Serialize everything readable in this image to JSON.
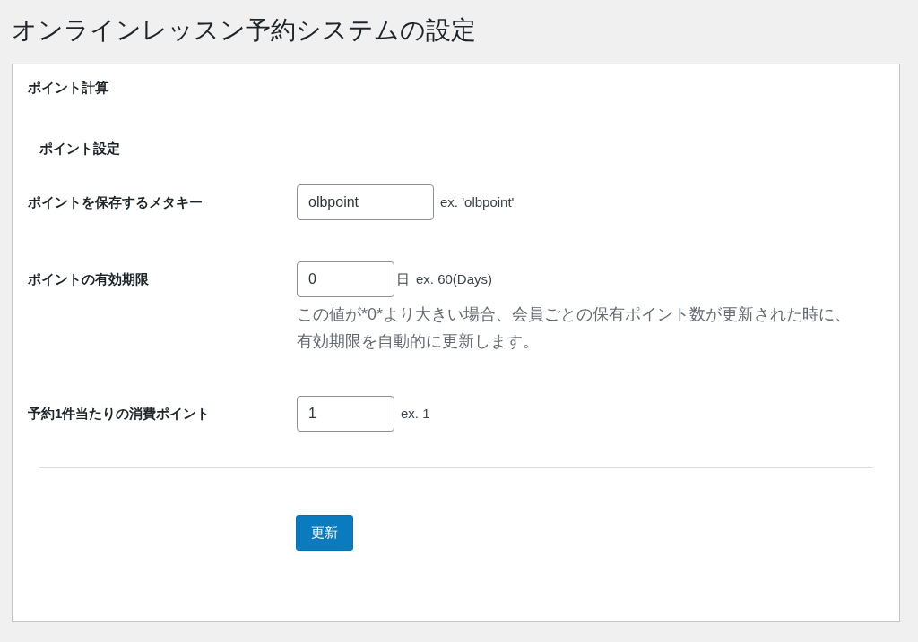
{
  "page_title": "オンラインレッスン予約システムの設定",
  "section_title": "ポイント計算",
  "subsection_title": "ポイント設定",
  "fields": [
    {
      "label": "ポイントを保存するメタキー",
      "value": "olbpoint",
      "kind": "text",
      "hint": "ex. 'olbpoint'"
    },
    {
      "label": "ポイントの有効期限",
      "value": "0",
      "kind": "number",
      "unit": "日",
      "hint": "ex. 60(Days)",
      "description": "この値が*0*より大きい場合、会員ごとの保有ポイント数が更新された時に、有効期限を自動的に更新します。"
    },
    {
      "label": "予約1件当たりの消費ポイント",
      "value": "1",
      "kind": "number",
      "hint": "ex. 1"
    }
  ],
  "submit_button": "更新"
}
